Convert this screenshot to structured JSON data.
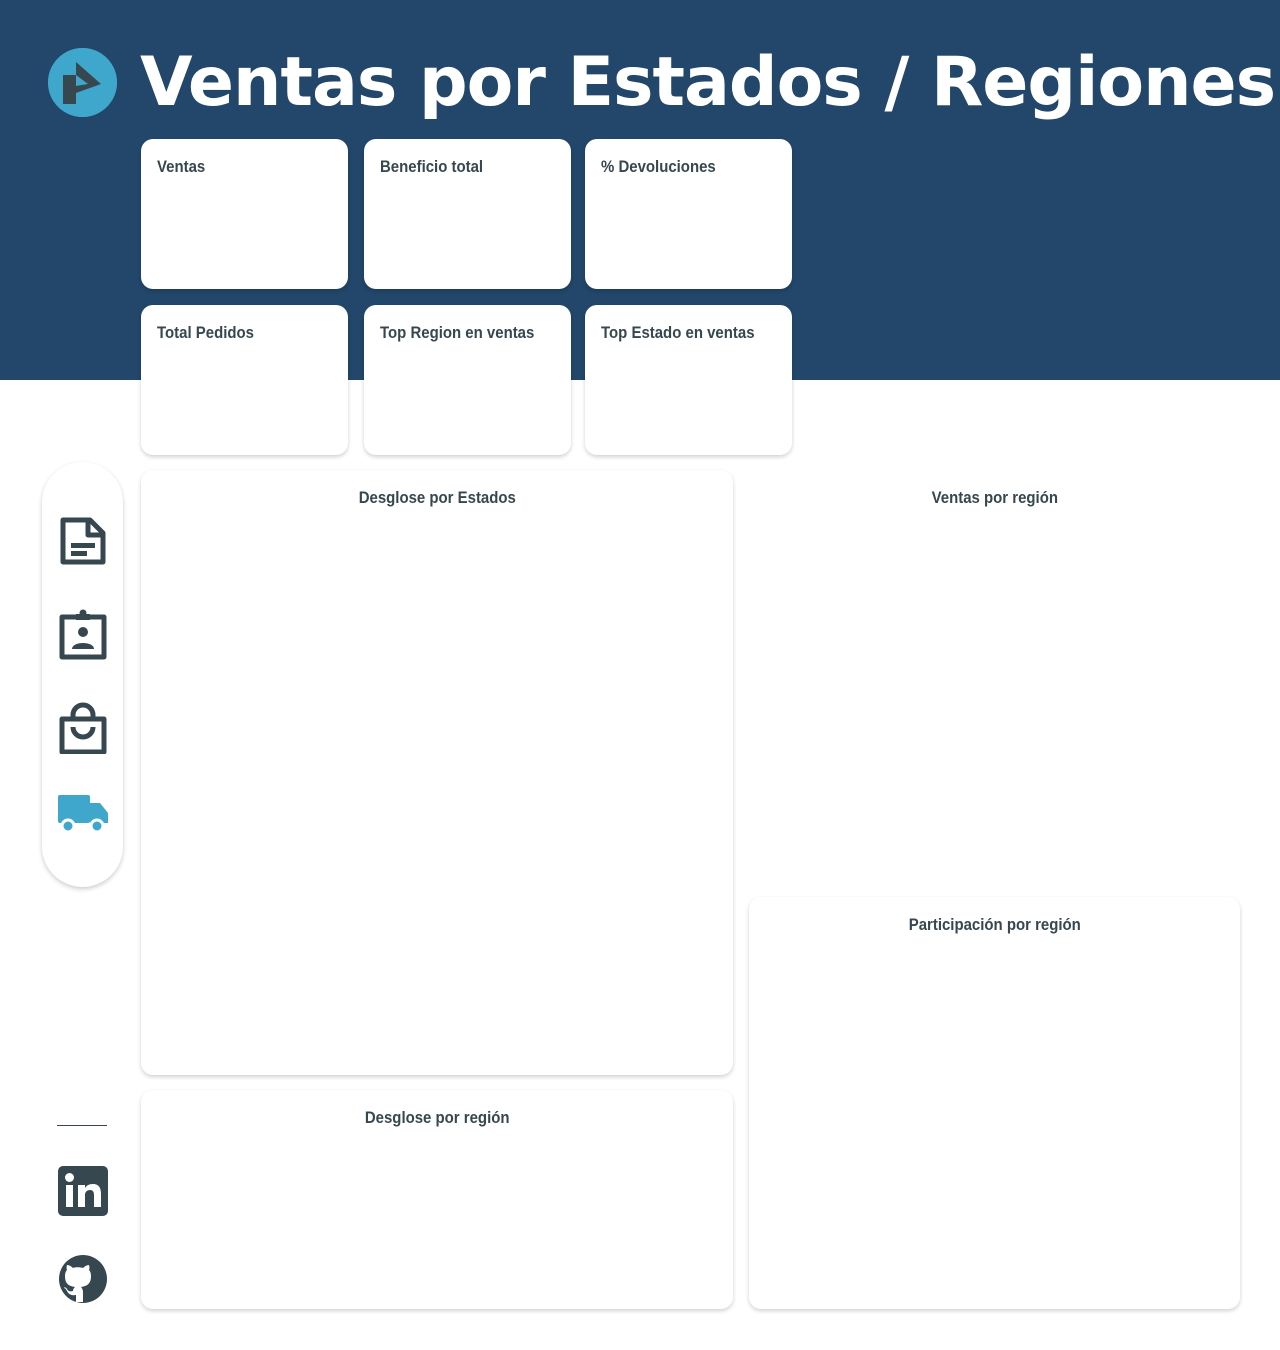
{
  "header": {
    "title": "Ventas por Estados / Regiones"
  },
  "logo": {
    "icon": "brand-logo-icon"
  },
  "kpis": [
    {
      "label": "Ventas"
    },
    {
      "label": "Beneficio total"
    },
    {
      "label": "% Devoluciones"
    },
    {
      "label": "Total Pedidos"
    },
    {
      "label": "Top Region en ventas"
    },
    {
      "label": "Top Estado en ventas"
    }
  ],
  "panels": {
    "desglose_estados": {
      "title": "Desglose por Estados"
    },
    "ventas_region": {
      "title": "Ventas por región"
    },
    "participacion_region": {
      "title": "Participación por región"
    },
    "desglose_region": {
      "title": "Desglose por región"
    }
  },
  "nav": {
    "items": [
      {
        "icon": "document-icon",
        "active": false
      },
      {
        "icon": "clipboard-account-icon",
        "active": false
      },
      {
        "icon": "shopping-bag-icon",
        "active": false
      },
      {
        "icon": "truck-icon",
        "active": true
      }
    ]
  },
  "social": [
    {
      "icon": "linkedin-icon"
    },
    {
      "icon": "github-icon"
    }
  ],
  "colors": {
    "header_bg": "#22476a",
    "accent": "#3fa7cc",
    "icon_dark": "#37474f",
    "card_bg": "#ffffff"
  }
}
